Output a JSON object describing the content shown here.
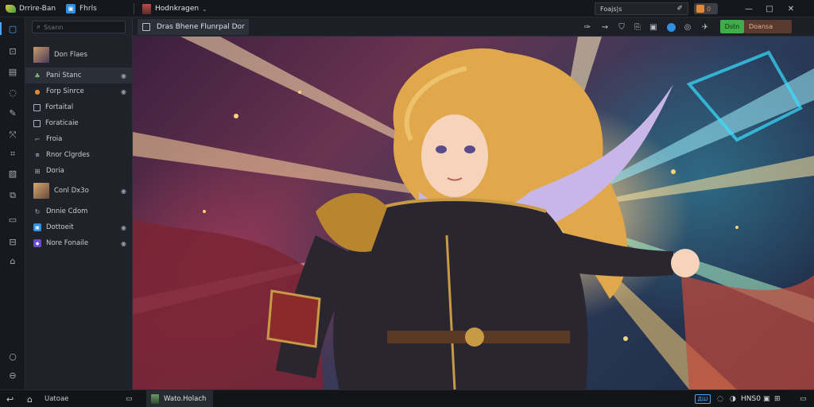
{
  "titlebar": {
    "app_name": "Drrire-Ban",
    "menu_label": "Fhrls",
    "project_name": "Hodnkragen",
    "search_value": "Foajs|s",
    "badge_value": "0",
    "minimize": "—",
    "maximize": "□",
    "close": "✕"
  },
  "panel": {
    "search_placeholder": "Ssann",
    "group1": "Don Flaes",
    "layers": [
      {
        "label": "Pani Stanc"
      },
      {
        "label": "Forp Sinrce"
      },
      {
        "label": "Fortaital"
      },
      {
        "label": "Foraticaie"
      },
      {
        "label": "Froia"
      },
      {
        "label": "Rnor Clgrdes"
      },
      {
        "label": "Doria"
      }
    ],
    "group2": "Conl Dx3o",
    "layers2": [
      {
        "label": "Dnnie Cdom"
      },
      {
        "label": "Dottoeit"
      },
      {
        "label": "Nore Fonaile"
      }
    ]
  },
  "doc": {
    "tab_label": "Dras Bhene Flunrpal Dor",
    "export_label": "Dstn",
    "share_label": "Doansa"
  },
  "statusbar": {
    "home_label": "Uatoae",
    "file_label": "Wato.Holach",
    "indicator": "ДШ",
    "clock": "HNS0"
  },
  "colors": {
    "accent": "#4aa3ff",
    "export_green": "#3fae4a",
    "share_brown": "#5a3a2e"
  },
  "icons": {
    "rail": [
      "select-icon",
      "layers-icon",
      "frame-icon",
      "lasso-icon",
      "brush-icon",
      "transform-icon",
      "crop-icon",
      "comment-icon",
      "stack-icon",
      "plugin-icon",
      "help-icon",
      "settings-icon"
    ],
    "toolbar": [
      "pen-icon",
      "share-icon",
      "save-icon",
      "copy-icon",
      "image-icon",
      "blue-dot-icon",
      "sync-icon",
      "pin-icon"
    ]
  }
}
